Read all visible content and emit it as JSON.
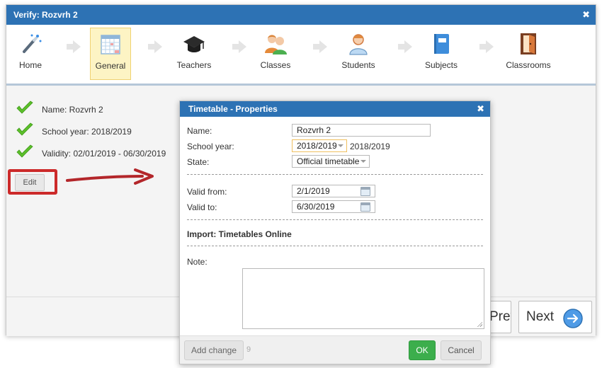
{
  "window": {
    "title": "Verify: Rozvrh 2"
  },
  "wizard": {
    "steps": [
      {
        "label": "Home",
        "icon": "magic-wand-icon"
      },
      {
        "label": "General",
        "icon": "grid-calendar-icon",
        "active": true
      },
      {
        "label": "Teachers",
        "icon": "graduation-cap-icon"
      },
      {
        "label": "Classes",
        "icon": "group-icon"
      },
      {
        "label": "Students",
        "icon": "student-icon"
      },
      {
        "label": "Subjects",
        "icon": "book-icon"
      },
      {
        "label": "Classrooms",
        "icon": "door-icon"
      }
    ]
  },
  "summary": {
    "name": "Name: Rozvrh 2",
    "school_year": "School year: 2018/2019",
    "validity": "Validity: 02/01/2019 - 06/30/2019",
    "edit_label": "Edit"
  },
  "nav": {
    "prev_label": "Prev",
    "next_label": "Next"
  },
  "dialog": {
    "title": "Timetable - Properties",
    "name_label": "Name:",
    "name_value": "Rozvrh 2",
    "school_year_label": "School year:",
    "school_year_value": "2018/2019",
    "school_year_text": "2018/2019",
    "state_label": "State:",
    "state_value": "Official timetable",
    "valid_from_label": "Valid from:",
    "valid_from_value": "2/1/2019",
    "valid_to_label": "Valid to:",
    "valid_to_value": "6/30/2019",
    "import_heading": "Import: Timetables Online",
    "note_label": "Note:",
    "add_change_label": "Add change",
    "change_count": "9",
    "ok_label": "OK",
    "cancel_label": "Cancel"
  },
  "colors": {
    "title_bar": "#2d72b4",
    "active_step": "#fdf4c4",
    "ok_button": "#3cae4c",
    "highlight": "#cc2a2a"
  }
}
